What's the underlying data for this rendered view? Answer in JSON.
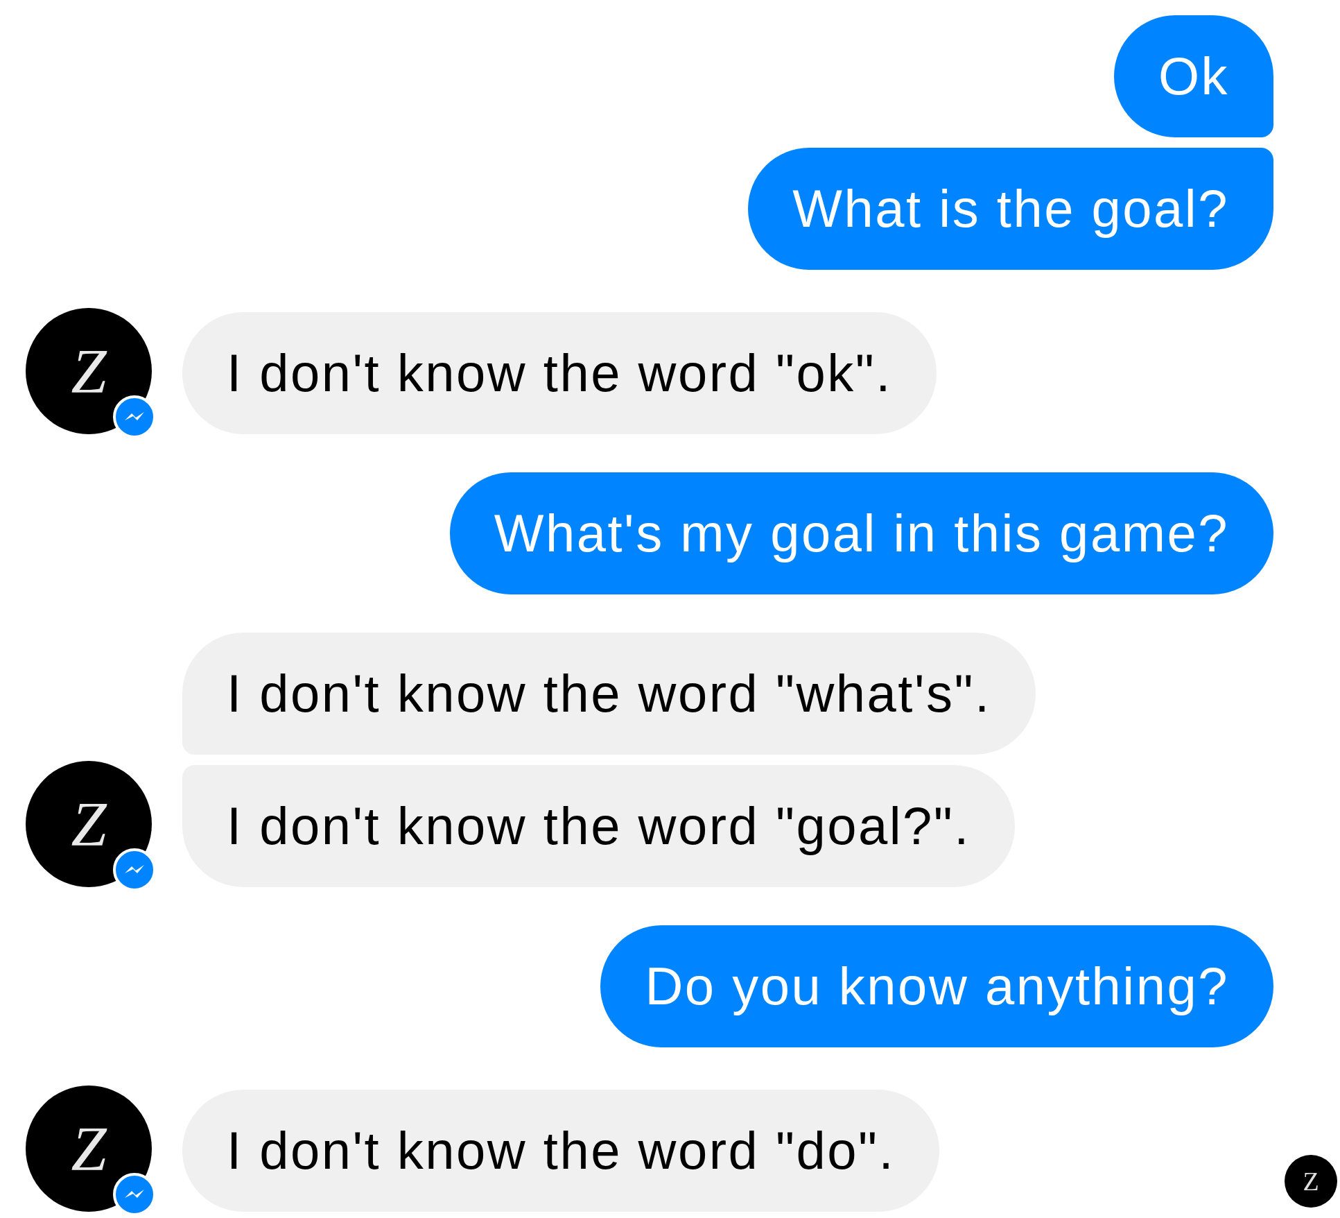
{
  "groups": [
    {
      "kind": "outgoing",
      "messages": [
        "Ok",
        "What is the goal?"
      ]
    },
    {
      "kind": "incoming",
      "avatar": "Z",
      "messages": [
        "I don't know the word \"ok\"."
      ]
    },
    {
      "kind": "outgoing",
      "messages": [
        "What's my goal in this game?"
      ]
    },
    {
      "kind": "incoming",
      "avatar": "Z",
      "messages": [
        "I don't know the word \"what's\".",
        "I don't know the word \"goal?\"."
      ]
    },
    {
      "kind": "outgoing",
      "messages": [
        "Do you know anything?"
      ]
    },
    {
      "kind": "incoming",
      "avatar": "Z",
      "messages": [
        "I don't know the word \"do\"."
      ]
    }
  ],
  "read_receipt": {
    "avatar": "Z"
  }
}
